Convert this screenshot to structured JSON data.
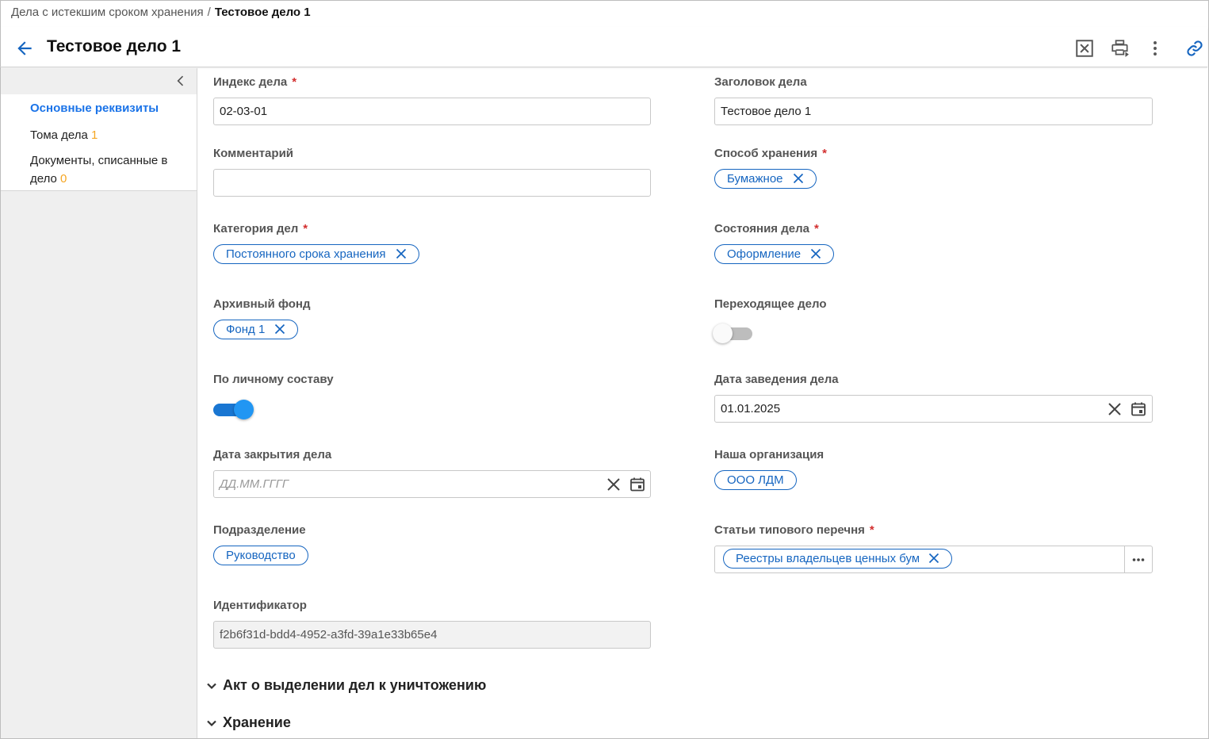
{
  "breadcrumb": {
    "parent": "Дела с истекшим сроком хранения",
    "separator": "/",
    "current": "Тестовое дело 1"
  },
  "header": {
    "title": "Тестовое дело 1",
    "icons": [
      "back-arrow-icon",
      "close-box-icon",
      "print-icon",
      "more-vert-icon",
      "link-icon"
    ]
  },
  "sidebar": {
    "items": [
      {
        "label": "Основные реквизиты",
        "count": ""
      },
      {
        "label": "Тома дела",
        "count": "1"
      },
      {
        "label": "Документы, списанные в дело",
        "count": "0"
      }
    ]
  },
  "form": {
    "index": {
      "label": "Индекс дела",
      "value": "02-03-01",
      "required": "*"
    },
    "title": {
      "label": "Заголовок дела",
      "value": "Тестовое дело 1"
    },
    "comment": {
      "label": "Комментарий",
      "value": ""
    },
    "storage_method": {
      "label": "Способ хранения",
      "required": "*",
      "chip": "Бумажное"
    },
    "category": {
      "label": "Категория дел",
      "required": "*",
      "chip": "Постоянного срока хранения"
    },
    "state": {
      "label": "Состояния дела",
      "required": "*",
      "chip": "Оформление"
    },
    "archive_fund": {
      "label": "Архивный фонд",
      "chip": "Фонд 1"
    },
    "transitional": {
      "label": "Переходящее дело",
      "on": false
    },
    "personnel": {
      "label": "По личному составу",
      "on": true
    },
    "open_date": {
      "label": "Дата заведения дела",
      "value": "01.01.2025"
    },
    "close_date": {
      "label": "Дата закрытия дела",
      "placeholder": "ДД.ММ.ГГГГ"
    },
    "organization": {
      "label": "Наша организация",
      "chip": "ООО ЛДМ"
    },
    "articles": {
      "label": "Статьи типового перечня",
      "required": "*",
      "chip": "Реестры владельцев ценных бумаг"
    },
    "department": {
      "label": "Подразделение",
      "chip": "Руководство"
    },
    "identifier": {
      "label": "Идентификатор",
      "value": "f2b6f31d-bdd4-4952-a3fd-39a1e33b65e4"
    }
  },
  "sections": [
    {
      "label": "Акт о выделении дел к уничтожению"
    },
    {
      "label": "Хранение"
    }
  ],
  "colors": {
    "accent": "#1565c0",
    "link": "#1a73e8",
    "required": "#d32f2f",
    "count": "#f5a623",
    "toggle_on": "#1976d2",
    "toggle_off": "#bdbdbd"
  }
}
